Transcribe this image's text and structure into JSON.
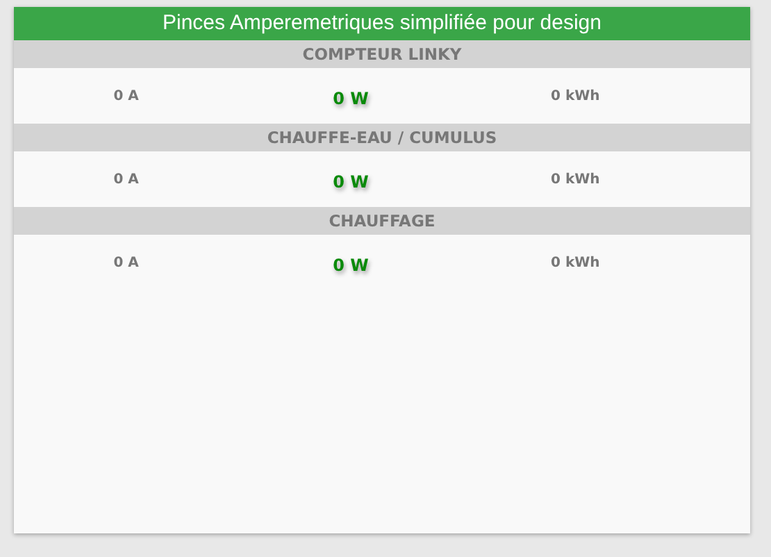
{
  "widget": {
    "title": "Pinces Amperemetriques simplifiée pour design"
  },
  "sections": [
    {
      "name": "COMPTEUR LINKY",
      "current": "0 A",
      "power": "0 W",
      "energy": "0 kWh"
    },
    {
      "name": "CHAUFFE-EAU / CUMULUS",
      "current": "0 A",
      "power": "0 W",
      "energy": "0 kWh"
    },
    {
      "name": "CHAUFFAGE",
      "current": "0 A",
      "power": "0 W",
      "energy": "0 kWh"
    }
  ]
}
